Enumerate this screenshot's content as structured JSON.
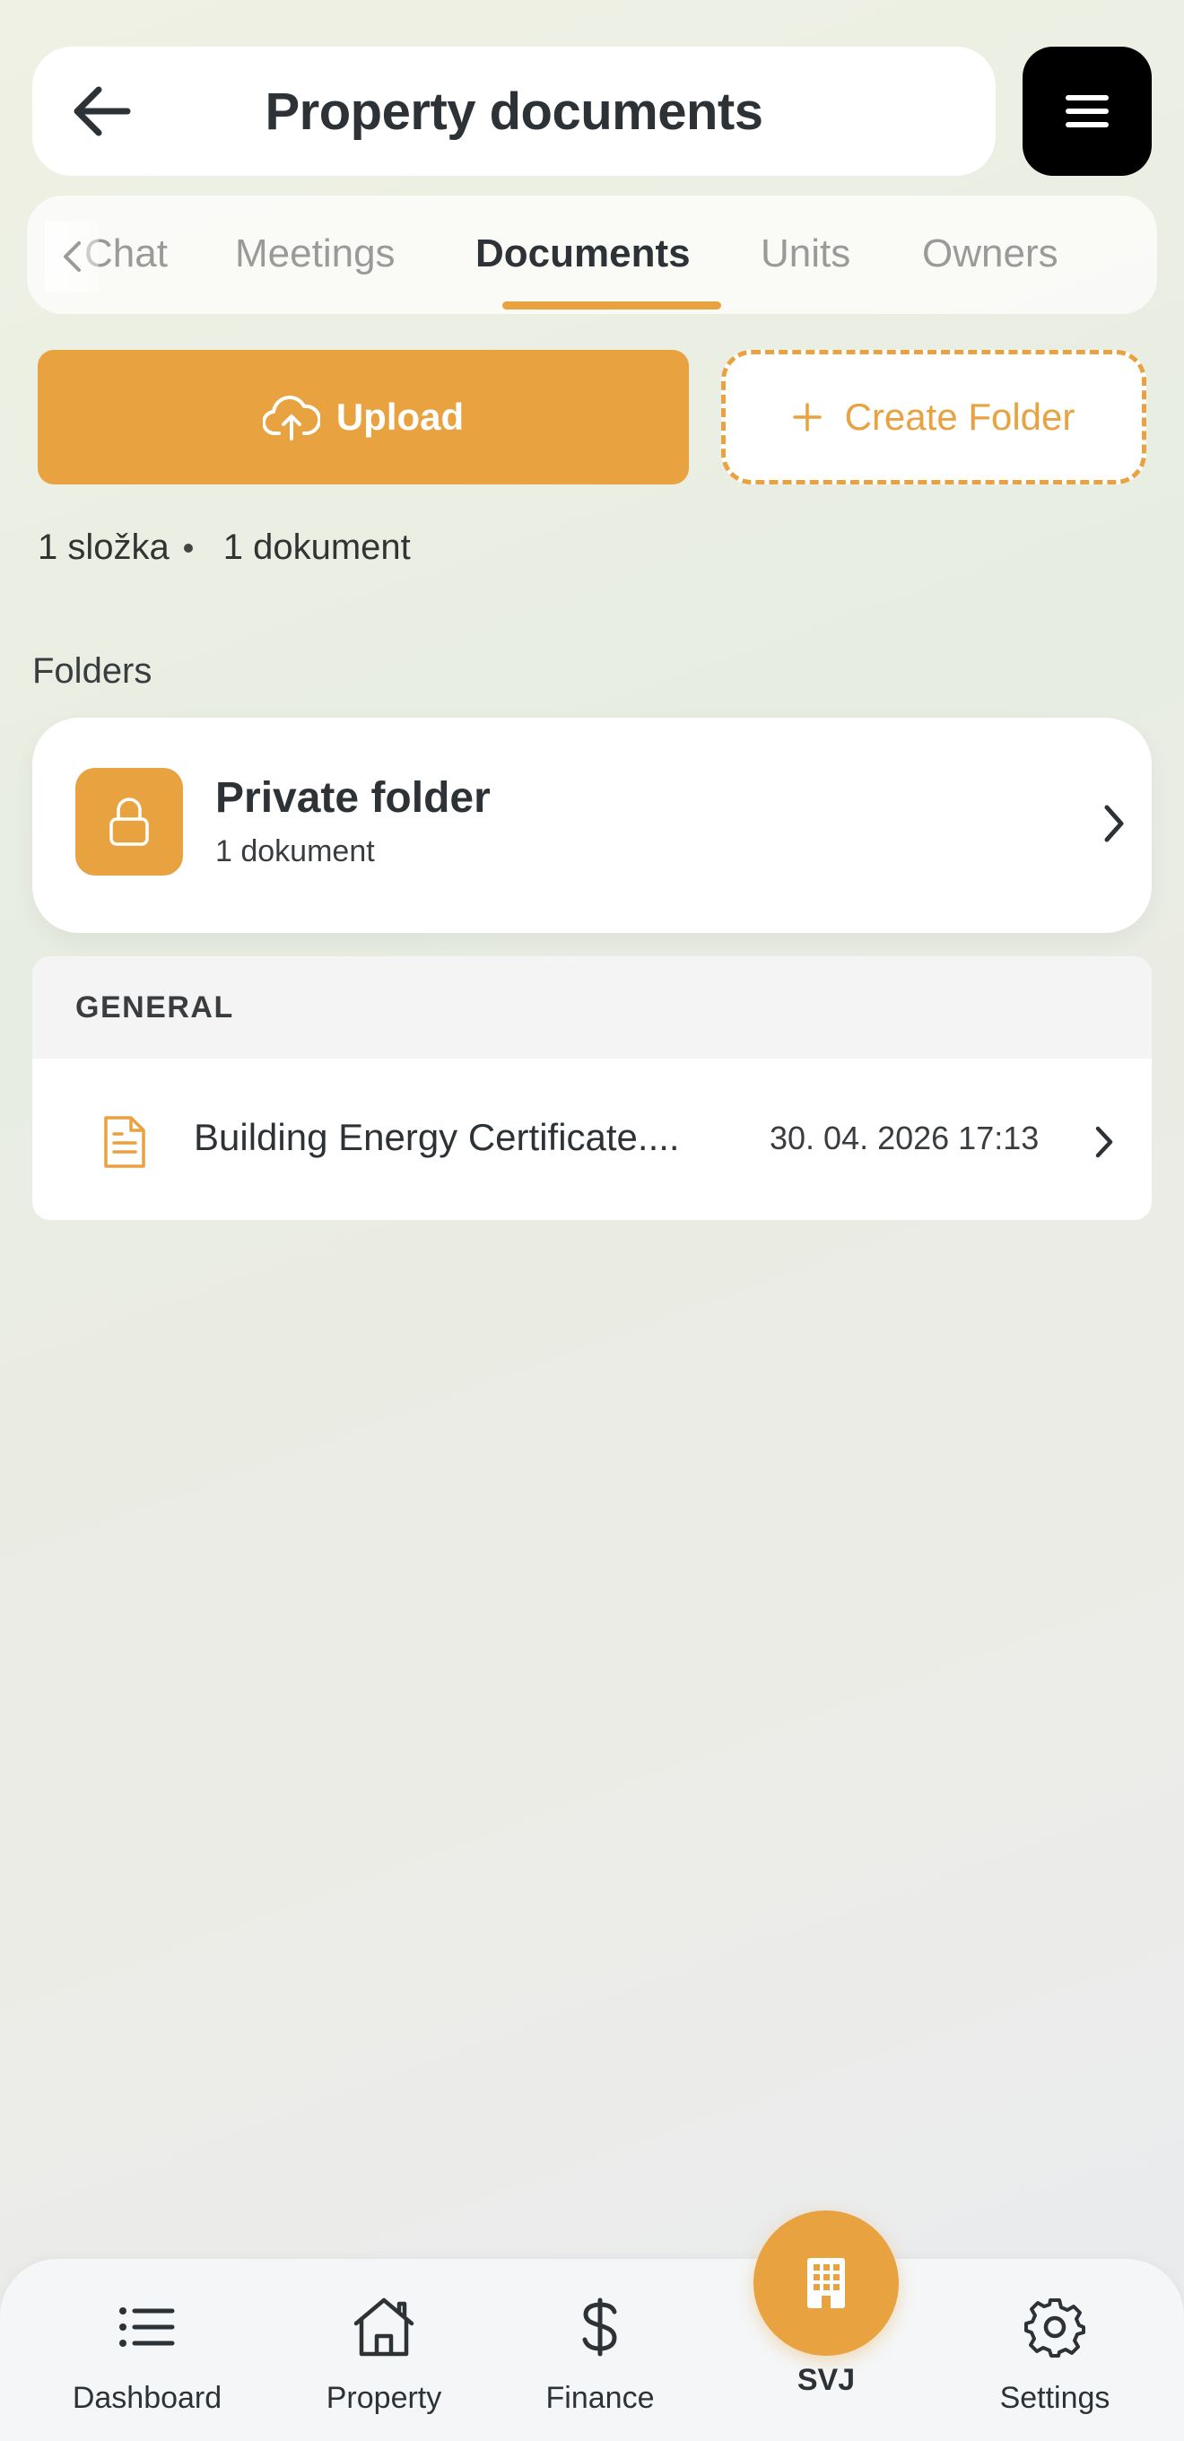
{
  "header": {
    "title": "Property documents",
    "back_icon": "arrow-left-icon",
    "menu_icon": "hamburger-menu-icon"
  },
  "tabs": [
    {
      "label": "Chat",
      "active": false
    },
    {
      "label": "Meetings",
      "active": false
    },
    {
      "label": "Documents",
      "active": true
    },
    {
      "label": "Units",
      "active": false
    },
    {
      "label": "Owners",
      "active": false
    }
  ],
  "actions": {
    "upload_label": "Upload",
    "create_folder_label": "Create Folder"
  },
  "summary": {
    "folders": "1 složka",
    "documents": "1 dokument"
  },
  "folders_section": {
    "label": "Folders",
    "items": [
      {
        "name": "Private folder",
        "count": "1 dokument",
        "icon": "lock-icon"
      }
    ]
  },
  "groups": [
    {
      "title": "GENERAL",
      "documents": [
        {
          "name": "Building Energy Certificate....",
          "date": "30. 04. 2026 17:13",
          "icon": "document-icon"
        }
      ]
    }
  ],
  "bottom_nav": {
    "items": [
      {
        "label": "Dashboard",
        "icon": "list-icon"
      },
      {
        "label": "Property",
        "icon": "house-icon"
      },
      {
        "label": "Finance",
        "icon": "dollar-icon"
      },
      {
        "label": "SVJ",
        "icon": "building-icon"
      },
      {
        "label": "Settings",
        "icon": "gear-icon"
      }
    ]
  },
  "colors": {
    "accent": "#e8a23f",
    "text_primary": "#2d3236",
    "tab_inactive": "#9a9a9a"
  }
}
